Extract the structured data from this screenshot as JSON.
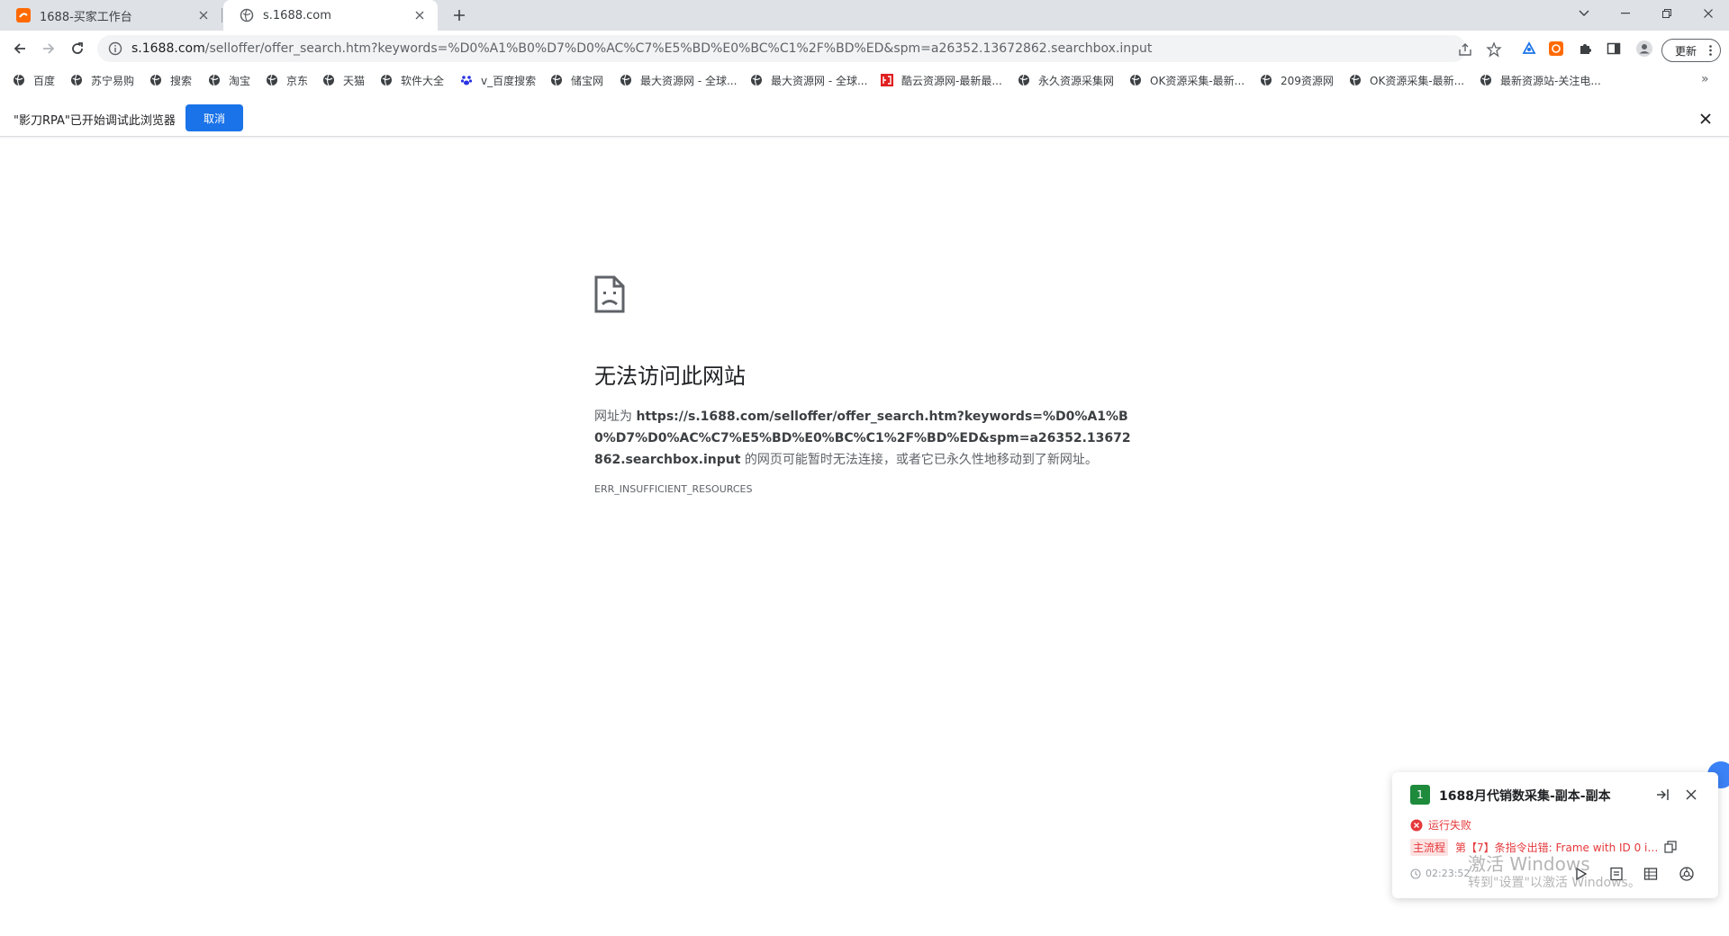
{
  "tabs": [
    {
      "title": "1688-买家工作台",
      "favicon": "alibaba-logo-icon",
      "active": false
    },
    {
      "title": "s.1688.com",
      "favicon": "globe-icon",
      "active": true
    }
  ],
  "address_bar": {
    "host": "s.1688.com",
    "path": "/selloffer/offer_search.htm?keywords=%D0%A1%B0%D7%D0%AC%C7%E5%BD%E0%BC%C1%2F%BD%ED&spm=a26352.13672862.searchbox.input"
  },
  "toolbar": {
    "update_label": "更新"
  },
  "bookmarks": [
    {
      "label": "百度",
      "icon": "globe-icon"
    },
    {
      "label": "苏宁易购",
      "icon": "globe-icon"
    },
    {
      "label": "搜索",
      "icon": "globe-icon"
    },
    {
      "label": "淘宝",
      "icon": "globe-icon"
    },
    {
      "label": "京东",
      "icon": "globe-icon"
    },
    {
      "label": "天猫",
      "icon": "globe-icon"
    },
    {
      "label": "软件大全",
      "icon": "globe-icon"
    },
    {
      "label": "v_百度搜索",
      "icon": "baidu-paw-icon"
    },
    {
      "label": "储宝网",
      "icon": "globe-icon"
    },
    {
      "label": "最大资源网 - 全球...",
      "icon": "globe-icon"
    },
    {
      "label": "最大资源网 - 全球...",
      "icon": "globe-icon"
    },
    {
      "label": "酷云资源网-最新最...",
      "icon": "kuyun-logo-icon"
    },
    {
      "label": "永久资源采集网",
      "icon": "globe-icon"
    },
    {
      "label": "OK资源采集-最新...",
      "icon": "globe-icon"
    },
    {
      "label": "209资源网",
      "icon": "globe-icon"
    },
    {
      "label": "OK资源采集-最新...",
      "icon": "globe-icon"
    },
    {
      "label": "最新资源站-关注电...",
      "icon": "globe-icon"
    }
  ],
  "bookmarks_more": "»",
  "infobar": {
    "message": "\"影刀RPA\"已开始调试此浏览器",
    "cancel_label": "取消"
  },
  "error_page": {
    "title": "无法访问此网站",
    "prefix": "网址为 ",
    "url": "https://s.1688.com/selloffer/offer_search.htm?keywords=%D0%A1%B0%D7%D0%AC%C7%E5%BD%E0%BC%C1%2F%BD%ED&spm=a26352.13672862.searchbox.input",
    "suffix": " 的网页可能暂时无法连接，或者它已永久性地移动到了新网址。",
    "error_code": "ERR_INSUFFICIENT_RESOURCES"
  },
  "rpa_panel": {
    "badge": "1",
    "title": "1688月代销数采集-副本-副本",
    "status": "运行失败",
    "error_tag": "主流程",
    "error_text": "第【7】条指令出错: Frame with ID 0 is...",
    "time": "02:23:52"
  },
  "watermark": {
    "line1": "激活 Windows",
    "line2": "转到\"设置\"以激活 Windows。"
  },
  "colors": {
    "tabstrip": "#dee1e6",
    "accent": "#1a73e8",
    "error": "#e5383b",
    "badge_green": "#1d8a3c"
  }
}
